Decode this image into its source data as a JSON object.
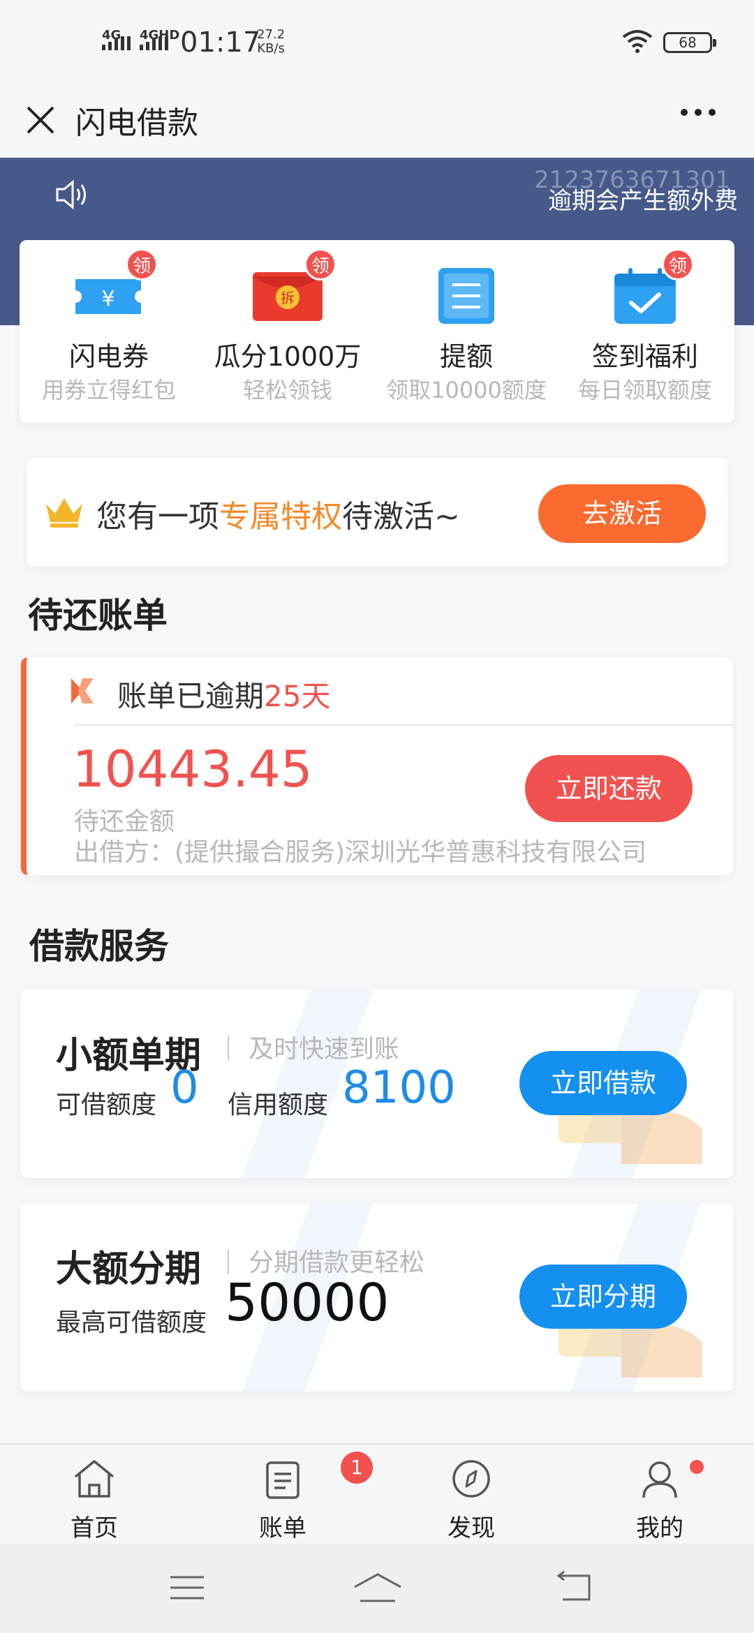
{
  "status_bar": {
    "net1": "4G",
    "net2": "4GHD",
    "time": "01:17",
    "speed_value": "27.2",
    "speed_unit": "KB/s",
    "battery": "68"
  },
  "nav": {
    "title": "闪电借款",
    "close_icon": "close-icon",
    "more_icon": "more-icon"
  },
  "banner": {
    "id_text": "2123763671301",
    "notice": "逾期会产生额外费"
  },
  "quick_menu": [
    {
      "title": "闪电券",
      "sub": "用券立得红包",
      "badge": "领",
      "icon": "coupon-icon"
    },
    {
      "title": "瓜分1000万",
      "sub": "轻松领钱",
      "badge": "领",
      "icon": "red-envelope-icon",
      "icon_text": "拆"
    },
    {
      "title": "提额",
      "sub": "领取10000额度",
      "icon": "document-icon"
    },
    {
      "title": "签到福利",
      "sub": "每日领取额度",
      "badge": "领",
      "icon": "calendar-check-icon"
    }
  ],
  "privilege": {
    "prefix": "您有一项",
    "highlight": "专属特权",
    "suffix": "待激活~",
    "button": "去激活"
  },
  "bills_section": {
    "title": "待还账单",
    "status_prefix": "账单已逾期",
    "overdue_days": "25天",
    "amount": "10443.45",
    "amount_label": "待还金额",
    "lender": "出借方：(提供撮合服务)深圳光华普惠科技有限公司",
    "button": "立即还款"
  },
  "loan_section": {
    "title": "借款服务",
    "small": {
      "name": "小额单期",
      "desc": "及时快速到账",
      "available_label": "可借额度",
      "available_value": "0",
      "credit_label": "信用额度",
      "credit_value": "8100",
      "button": "立即借款"
    },
    "large": {
      "name": "大额分期",
      "desc": "分期借款更轻松",
      "max_label": "最高可借额度",
      "max_value": "50000",
      "button": "立即分期"
    }
  },
  "tab_bar": [
    {
      "label": "首页",
      "icon": "home-icon"
    },
    {
      "label": "账单",
      "icon": "bill-icon",
      "badge": "1"
    },
    {
      "label": "发现",
      "icon": "compass-icon"
    },
    {
      "label": "我的",
      "icon": "user-icon"
    }
  ],
  "colors": {
    "banner": "#46598a",
    "accent_orange": "#fb6a2e",
    "accent_red": "#f2524f",
    "accent_blue": "#1490f0",
    "highlight_orange": "#f28a2a"
  }
}
